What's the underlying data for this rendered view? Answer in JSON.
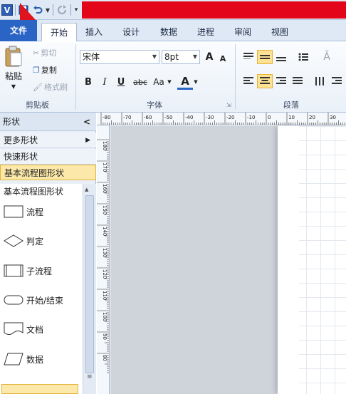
{
  "qat": {
    "app_icon_label": "V",
    "save_icon": "save-icon",
    "undo_icon": "undo-icon",
    "redo_icon": "redo-icon",
    "accent_color": "#e3061a"
  },
  "tabs": {
    "file": "文件",
    "items": [
      "开始",
      "插入",
      "设计",
      "数据",
      "进程",
      "审阅",
      "视图"
    ]
  },
  "ribbon": {
    "clipboard": {
      "paste": "粘贴",
      "cut": "剪切",
      "copy": "复制",
      "format_painter": "格式刷",
      "group": "剪贴板"
    },
    "font": {
      "name": "宋体",
      "size": "8pt",
      "grow": "A",
      "shrink": "A",
      "bold": "B",
      "italic": "I",
      "underline": "U",
      "strike": "abc",
      "case": "Aa",
      "color": "A",
      "group": "字体"
    },
    "paragraph": {
      "group": "段落"
    }
  },
  "shapes_panel": {
    "title": "形状",
    "collapse": "<",
    "more_shapes": "更多形状",
    "more_arrow": "▶",
    "quick_shapes": "快速形状",
    "selected_stencil": "基本流程图形状",
    "stencil_title": "基本流程图形状",
    "shapes": [
      "流程",
      "判定",
      "子流程",
      "开始/结束",
      "文档",
      "数据"
    ]
  },
  "rulers": {
    "h_labels": [
      "-80",
      "-70",
      "-60",
      "-50",
      "-40",
      "-30",
      "-20",
      "-10",
      "0",
      "10",
      "20",
      "30"
    ],
    "v_labels": [
      "180",
      "170",
      "160",
      "150",
      "140",
      "130",
      "120",
      "110",
      "100",
      "90",
      "80"
    ]
  }
}
